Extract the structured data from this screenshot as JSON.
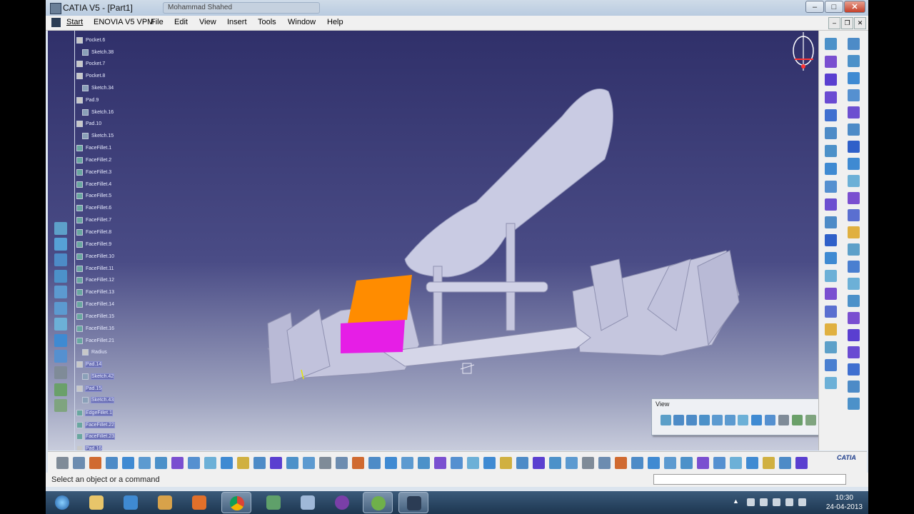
{
  "window": {
    "title": "CATIA V5 - [Part1]",
    "background_tab_title": "Mohammad Shahed"
  },
  "menu": {
    "items": [
      "Start",
      "ENOVIA V5 VPM",
      "File",
      "Edit",
      "View",
      "Insert",
      "Tools",
      "Window",
      "Help"
    ],
    "active": "Start"
  },
  "tree": {
    "items": [
      {
        "label": "Pocket.6",
        "type": "pocket"
      },
      {
        "label": "Sketch.38",
        "type": "sketch"
      },
      {
        "label": "Pocket.7",
        "type": "pocket"
      },
      {
        "label": "Pocket.8",
        "type": "pocket"
      },
      {
        "label": "Sketch.34",
        "type": "sketch"
      },
      {
        "label": "Pad.9",
        "type": "pad"
      },
      {
        "label": "Sketch.16",
        "type": "sketch"
      },
      {
        "label": "Pad.10",
        "type": "pad"
      },
      {
        "label": "Sketch.15",
        "type": "sketch"
      },
      {
        "label": "FaceFillet.1",
        "type": "fillet"
      },
      {
        "label": "FaceFillet.2",
        "type": "fillet"
      },
      {
        "label": "FaceFillet.3",
        "type": "fillet"
      },
      {
        "label": "FaceFillet.4",
        "type": "fillet"
      },
      {
        "label": "FaceFillet.5",
        "type": "fillet"
      },
      {
        "label": "FaceFillet.6",
        "type": "fillet"
      },
      {
        "label": "FaceFillet.7",
        "type": "fillet"
      },
      {
        "label": "FaceFillet.8",
        "type": "fillet"
      },
      {
        "label": "FaceFillet.9",
        "type": "fillet"
      },
      {
        "label": "FaceFillet.10",
        "type": "fillet"
      },
      {
        "label": "FaceFillet.11",
        "type": "fillet"
      },
      {
        "label": "FaceFillet.12",
        "type": "fillet"
      },
      {
        "label": "FaceFillet.13",
        "type": "fillet"
      },
      {
        "label": "FaceFillet.14",
        "type": "fillet"
      },
      {
        "label": "FaceFillet.15",
        "type": "fillet"
      },
      {
        "label": "FaceFillet.16",
        "type": "fillet"
      },
      {
        "label": "FaceFillet.21",
        "type": "fillet"
      },
      {
        "label": "Radius",
        "type": "param"
      },
      {
        "label": "Pad.14",
        "type": "pad"
      },
      {
        "label": "Sketch.42",
        "type": "sketch"
      },
      {
        "label": "Pad.15",
        "type": "pad"
      },
      {
        "label": "Sketch.43",
        "type": "sketch"
      },
      {
        "label": "EdgeFillet.1",
        "type": "fillet"
      },
      {
        "label": "FaceFillet.22",
        "type": "fillet"
      },
      {
        "label": "FaceFillet.23",
        "type": "fillet"
      },
      {
        "label": "Pad.16",
        "type": "pad"
      }
    ]
  },
  "view_toolbar": {
    "title": "View"
  },
  "status": {
    "prompt": "Select an object or a command"
  },
  "taskbar": {
    "time": "10:30",
    "date": "24-04-2013"
  },
  "brand": {
    "logo_text": "CATIA"
  },
  "colors": {
    "viewport_top": "#30306a",
    "model_body": "#c5c6de",
    "highlight_orange": "#ff8c00",
    "highlight_magenta": "#e61ee6"
  }
}
